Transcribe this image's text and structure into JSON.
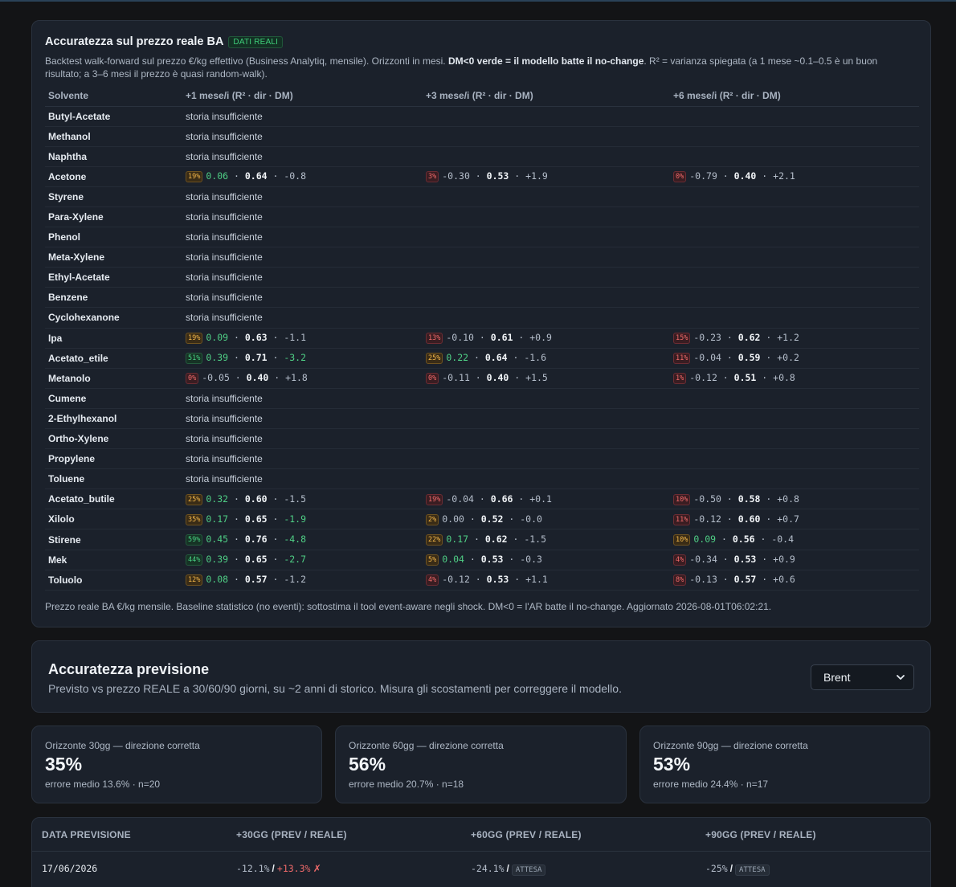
{
  "accuracy": {
    "title": "Accuratezza sul prezzo reale BA",
    "badge": "DATI REALI",
    "desc_pre": "Backtest walk-forward sul prezzo €/kg effettivo (Business Analytiq, mensile). Orizzonti in mesi. ",
    "desc_bold": "DM<0 verde = il modello batte il no-change",
    "desc_post": ". R² = varianza spiegata (a 1 mese ~0.1–0.5 è un buon risultato; a 3–6 mesi il prezzo è quasi random-walk).",
    "columns": [
      "Solvente",
      "+1 mese/i (R² · dir · DM)",
      "+3 mese/i (R² · dir · DM)",
      "+6 mese/i (R² · dir · DM)"
    ],
    "insufficient": "storia insufficiente",
    "rows": [
      {
        "name": "Butyl-Acetate",
        "h": null
      },
      {
        "name": "Methanol",
        "h": null
      },
      {
        "name": "Naphtha",
        "h": null
      },
      {
        "name": "Acetone",
        "h": [
          {
            "dir": "19%",
            "tone": "amber",
            "r2": "0.06",
            "r2pos": true,
            "rmse": "0.64",
            "dm": "-0.8",
            "dmpos": false
          },
          {
            "dir": "3%",
            "tone": "red",
            "r2": "-0.30",
            "r2pos": false,
            "rmse": "0.53",
            "dm": "+1.9",
            "dmpos": false
          },
          {
            "dir": "0%",
            "tone": "red",
            "r2": "-0.79",
            "r2pos": false,
            "rmse": "0.40",
            "dm": "+2.1",
            "dmpos": false
          }
        ]
      },
      {
        "name": "Styrene",
        "h": null
      },
      {
        "name": "Para-Xylene",
        "h": null
      },
      {
        "name": "Phenol",
        "h": null
      },
      {
        "name": "Meta-Xylene",
        "h": null
      },
      {
        "name": "Ethyl-Acetate",
        "h": null
      },
      {
        "name": "Benzene",
        "h": null
      },
      {
        "name": "Cyclohexanone",
        "h": null
      },
      {
        "name": "Ipa",
        "h": [
          {
            "dir": "19%",
            "tone": "amber",
            "r2": "0.09",
            "r2pos": true,
            "rmse": "0.63",
            "dm": "-1.1",
            "dmpos": false
          },
          {
            "dir": "13%",
            "tone": "red",
            "r2": "-0.10",
            "r2pos": false,
            "rmse": "0.61",
            "dm": "+0.9",
            "dmpos": false
          },
          {
            "dir": "15%",
            "tone": "red",
            "r2": "-0.23",
            "r2pos": false,
            "rmse": "0.62",
            "dm": "+1.2",
            "dmpos": false
          }
        ]
      },
      {
        "name": "Acetato_etile",
        "h": [
          {
            "dir": "51%",
            "tone": "green",
            "r2": "0.39",
            "r2pos": true,
            "rmse": "0.71",
            "dm": "-3.2",
            "dmpos": true
          },
          {
            "dir": "25%",
            "tone": "amber",
            "r2": "0.22",
            "r2pos": true,
            "rmse": "0.64",
            "dm": "-1.6",
            "dmpos": false
          },
          {
            "dir": "11%",
            "tone": "red",
            "r2": "-0.04",
            "r2pos": false,
            "rmse": "0.59",
            "dm": "+0.2",
            "dmpos": false
          }
        ]
      },
      {
        "name": "Metanolo",
        "h": [
          {
            "dir": "0%",
            "tone": "red",
            "r2": "-0.05",
            "r2pos": false,
            "rmse": "0.40",
            "dm": "+1.8",
            "dmpos": false
          },
          {
            "dir": "0%",
            "tone": "red",
            "r2": "-0.11",
            "r2pos": false,
            "rmse": "0.40",
            "dm": "+1.5",
            "dmpos": false
          },
          {
            "dir": "1%",
            "tone": "red",
            "r2": "-0.12",
            "r2pos": false,
            "rmse": "0.51",
            "dm": "+0.8",
            "dmpos": false
          }
        ]
      },
      {
        "name": "Cumene",
        "h": null
      },
      {
        "name": "2-Ethylhexanol",
        "h": null
      },
      {
        "name": "Ortho-Xylene",
        "h": null
      },
      {
        "name": "Propylene",
        "h": null
      },
      {
        "name": "Toluene",
        "h": null
      },
      {
        "name": "Acetato_butile",
        "h": [
          {
            "dir": "25%",
            "tone": "amber",
            "r2": "0.32",
            "r2pos": true,
            "rmse": "0.60",
            "dm": "-1.5",
            "dmpos": false
          },
          {
            "dir": "19%",
            "tone": "red",
            "r2": "-0.04",
            "r2pos": false,
            "rmse": "0.66",
            "dm": "+0.1",
            "dmpos": false
          },
          {
            "dir": "10%",
            "tone": "red",
            "r2": "-0.50",
            "r2pos": false,
            "rmse": "0.58",
            "dm": "+0.8",
            "dmpos": false
          }
        ]
      },
      {
        "name": "Xilolo",
        "h": [
          {
            "dir": "35%",
            "tone": "amber",
            "r2": "0.17",
            "r2pos": true,
            "rmse": "0.65",
            "dm": "-1.9",
            "dmpos": true
          },
          {
            "dir": "2%",
            "tone": "amber",
            "r2": "0.00",
            "r2pos": false,
            "rmse": "0.52",
            "dm": "-0.0",
            "dmpos": false
          },
          {
            "dir": "11%",
            "tone": "red",
            "r2": "-0.12",
            "r2pos": false,
            "rmse": "0.60",
            "dm": "+0.7",
            "dmpos": false
          }
        ]
      },
      {
        "name": "Stirene",
        "h": [
          {
            "dir": "59%",
            "tone": "green",
            "r2": "0.45",
            "r2pos": true,
            "rmse": "0.76",
            "dm": "-4.8",
            "dmpos": true
          },
          {
            "dir": "22%",
            "tone": "amber",
            "r2": "0.17",
            "r2pos": true,
            "rmse": "0.62",
            "dm": "-1.5",
            "dmpos": false
          },
          {
            "dir": "10%",
            "tone": "amber",
            "r2": "0.09",
            "r2pos": true,
            "rmse": "0.56",
            "dm": "-0.4",
            "dmpos": false
          }
        ]
      },
      {
        "name": "Mek",
        "h": [
          {
            "dir": "44%",
            "tone": "green",
            "r2": "0.39",
            "r2pos": true,
            "rmse": "0.65",
            "dm": "-2.7",
            "dmpos": true
          },
          {
            "dir": "5%",
            "tone": "amber",
            "r2": "0.04",
            "r2pos": true,
            "rmse": "0.53",
            "dm": "-0.3",
            "dmpos": false
          },
          {
            "dir": "4%",
            "tone": "red",
            "r2": "-0.34",
            "r2pos": false,
            "rmse": "0.53",
            "dm": "+0.9",
            "dmpos": false
          }
        ]
      },
      {
        "name": "Toluolo",
        "h": [
          {
            "dir": "12%",
            "tone": "amber",
            "r2": "0.08",
            "r2pos": true,
            "rmse": "0.57",
            "dm": "-1.2",
            "dmpos": false
          },
          {
            "dir": "4%",
            "tone": "red",
            "r2": "-0.12",
            "r2pos": false,
            "rmse": "0.53",
            "dm": "+1.1",
            "dmpos": false
          },
          {
            "dir": "8%",
            "tone": "red",
            "r2": "-0.13",
            "r2pos": false,
            "rmse": "0.57",
            "dm": "+0.6",
            "dmpos": false
          }
        ]
      }
    ],
    "footer": "Prezzo reale BA €/kg mensile. Baseline statistico (no eventi): sottostima il tool event-aware negli shock. DM<0 = l'AR batte il no-change. Aggiornato 2026-08-01T06:02:21."
  },
  "forecast": {
    "title": "Accuratezza previsione",
    "subtitle": "Previsto vs prezzo REALE a 30/60/90 giorni, su ~2 anni di storico. Misura gli scostamenti per correggere il modello.",
    "select_value": "Brent"
  },
  "cards": [
    {
      "label": "Orizzonte 30gg — direzione corretta",
      "value": "35%",
      "sub": "errore medio 13.6% · n=20"
    },
    {
      "label": "Orizzonte 60gg — direzione corretta",
      "value": "56%",
      "sub": "errore medio 20.7% · n=18"
    },
    {
      "label": "Orizzonte 90gg — direzione corretta",
      "value": "53%",
      "sub": "errore medio 24.4% · n=17"
    }
  ],
  "history": {
    "headers": [
      "DATA PREVISIONE",
      "+30GG (PREV / REALE)",
      "+60GG (PREV / REALE)",
      "+90GG (PREV / REALE)"
    ],
    "row": {
      "date": "17/06/2026",
      "p30": "-12.1%",
      "r30": "+13.3%",
      "mark30": "✗",
      "p60": "-24.1%",
      "r60": "ATTESA",
      "p90": "-25%",
      "r90": "ATTESA"
    }
  },
  "colors": {
    "accent_green": "#4fcf85",
    "accent_red": "#f06a6a",
    "accent_amber": "#f2b64a",
    "panel": "#1b212b",
    "background": "#131416"
  }
}
